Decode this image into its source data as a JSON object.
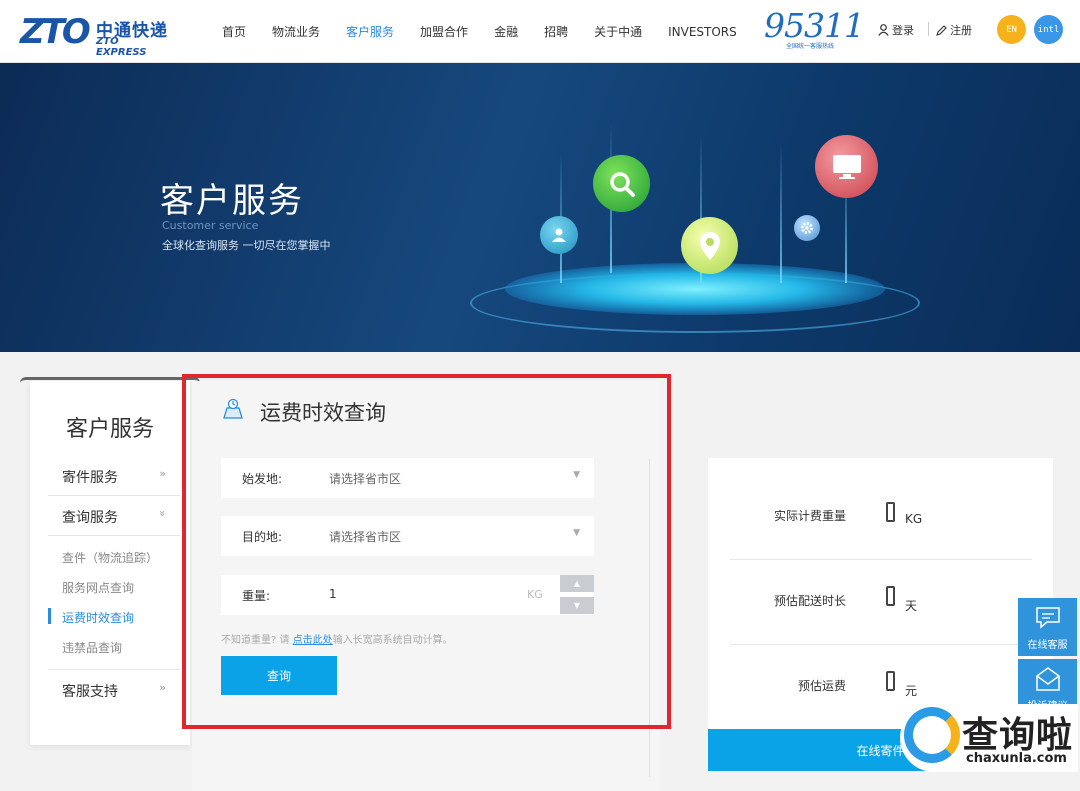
{
  "header": {
    "logo_mark": "ZTO",
    "logo_cn": "中通快递",
    "logo_en": "ZTO EXPRESS",
    "nav": [
      "首页",
      "物流业务",
      "客户服务",
      "加盟合作",
      "金融",
      "招聘",
      "关于中通",
      "INVESTORS"
    ],
    "active_nav": "客户服务",
    "hotline": "95311",
    "hotline_sub": "全国统一客服热线",
    "login": "登录",
    "register": "注册",
    "lang_en": "EN",
    "lang_intl": "intl",
    "colors": {
      "brand": "#1a56a8",
      "accent": "#2a8be0",
      "en_btn": "#f5b21b",
      "intl_btn": "#3a96e6"
    }
  },
  "banner": {
    "title": "客户服务",
    "subtitle_en": "Customer service",
    "tagline": "全球化查询服务 一切尽在您掌握中",
    "icons": [
      "search-icon",
      "monitor-icon",
      "user-icon",
      "location-pin-icon",
      "gear-icon"
    ]
  },
  "sidebar": {
    "title": "客户服务",
    "sections": [
      {
        "label": "寄件服务",
        "arrow": "»"
      },
      {
        "label": "查询服务",
        "arrow": "»"
      },
      {
        "label": "客服支持",
        "arrow": "»"
      }
    ],
    "sub_items": [
      "查件（物流追踪）",
      "服务网点查询",
      "运费时效查询",
      "违禁品查询"
    ],
    "active_sub": "运费时效查询"
  },
  "form": {
    "title": "运费时效查询",
    "origin_label": "始发地:",
    "origin_placeholder": "请选择省市区",
    "dest_label": "目的地:",
    "dest_placeholder": "请选择省市区",
    "weight_label": "重量:",
    "weight_value": "1",
    "weight_unit": "KG",
    "hint_before": "不知道重量? 请",
    "hint_link": "点击此处",
    "hint_after": "输入长宽高系统自动计算。",
    "query_button": "查询",
    "button_color": "#0aa3e8",
    "highlight_color": "#e1262d"
  },
  "result": {
    "rows": [
      {
        "label": "实际计费重量",
        "unit": "KG"
      },
      {
        "label": "预估配送时长",
        "unit": "天"
      },
      {
        "label": "预估运费",
        "unit": "元"
      }
    ],
    "online_button": "在线寄件"
  },
  "float": {
    "service": "在线客服",
    "feedback": "投诉建议"
  },
  "watermark": {
    "text": "查询啦",
    "url": "chaxunla.com"
  }
}
